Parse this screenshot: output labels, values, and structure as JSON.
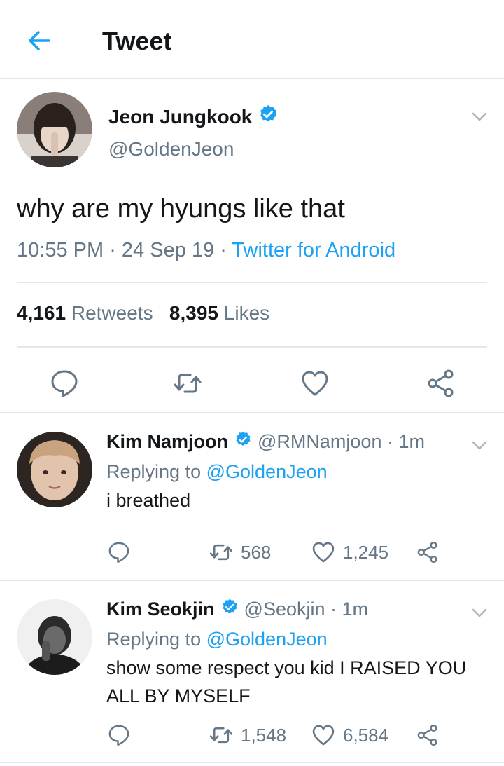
{
  "header": {
    "title": "Tweet"
  },
  "colors": {
    "accent": "#1da1f2",
    "muted": "#657786",
    "text": "#14171a",
    "divider": "#e1e8ed"
  },
  "tweet": {
    "name": "Jeon Jungkook",
    "handle": "@GoldenJeon",
    "text": "why are my hyungs like that",
    "time": "10:55 PM",
    "date": "24 Sep 19",
    "source": "Twitter for Android",
    "retweets": "4,161",
    "retweets_label": "Retweets",
    "likes": "8,395",
    "likes_label": "Likes"
  },
  "replies": [
    {
      "name": "Kim Namjoon",
      "handle": "@RMNamjoon · 1m",
      "replying_label": "Replying to",
      "mention": "@GoldenJeon",
      "text": "i breathed",
      "retweets": "568",
      "likes": "1,245"
    },
    {
      "name": "Kim Seokjin",
      "handle": "@Seokjin · 1m",
      "replying_label": "Replying to",
      "mention": "@GoldenJeon",
      "text": "show some respect you kid I RAISED YOU ALL BY MYSELF",
      "retweets": "1,548",
      "likes": "6,584"
    }
  ]
}
